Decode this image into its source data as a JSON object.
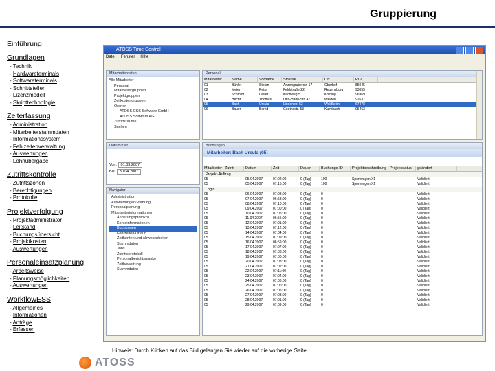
{
  "page": {
    "title": "Gruppierung"
  },
  "nav": {
    "sections": [
      {
        "label": "Einführung",
        "items": []
      },
      {
        "label": "Grundlagen",
        "items": [
          "Technik",
          "Hardwareterminals",
          "Softwareterminals",
          "Schnittstellen",
          "Lizenzmodell",
          "Skripttechnologie"
        ]
      },
      {
        "label": "Zeiterfassung",
        "items": [
          "Administration",
          "Mitarbeiterstammdaten",
          "Informationssystem",
          "Fehlzeitenverwaltung",
          "Auswertungen",
          "Lohnübergabe"
        ]
      },
      {
        "label": "Zutrittskontrolle",
        "items": [
          "Zutrittszonen",
          "Berechtigungen",
          "Protokolle"
        ]
      },
      {
        "label": "Projektverfolgung",
        "items": [
          "Projektadministrator",
          "Leitstand",
          "Buchungsübersicht",
          "Projektkosten",
          "Auswertungen"
        ]
      },
      {
        "label": "Personaleinsatzplanung",
        "items": [
          "Arbeitsweise",
          "Planungsmöglichkeiten",
          "Auswertungen"
        ]
      },
      {
        "label": "WorkflowESS",
        "items": [
          "Allgemeines",
          "Informationen",
          "Anträge",
          "Erfassen"
        ]
      }
    ]
  },
  "screenshot": {
    "window_title": "ATOSS Time Control",
    "menu": [
      "Datei",
      "Fenster",
      "Hilfe"
    ],
    "employees_header": [
      "Mitarbeiter",
      "Name",
      "Vorname",
      "Strasse",
      "Ort",
      "PLZ"
    ],
    "employees": [
      [
        "01",
        "Bühler",
        "Stefan",
        "Anzengruberstr. 17",
        "Oberhof",
        "85045"
      ],
      [
        "02",
        "Meier",
        "Petra",
        "Feldstraße 22",
        "Regensburg",
        "93055"
      ],
      [
        "03",
        "Schmidt",
        "Dieter",
        "Kirchweg 5",
        "Kölbing",
        "96969"
      ],
      [
        "04",
        "Hecht",
        "Thomas",
        "Otto-Hahn-Str. 47",
        "Weiden",
        "92637"
      ],
      [
        "05",
        "Bach",
        "Ursula",
        "Lindenstr. 52",
        "Waldheim",
        "67478"
      ],
      [
        "06",
        "Bauer",
        "Bernd",
        "Goethestr. 53",
        "Kulmbach",
        "95463"
      ]
    ],
    "banner": "Mitarbeiter: Bach Ursula (05)",
    "bookings_header": [
      "Mitarbeiter",
      "Zutritt",
      "Datum",
      "Zeit",
      "Dauer",
      "Buchungs-ID",
      "Projektbeschreibung",
      "Projektstatus",
      "geändert"
    ],
    "group1": "Projekt-Auftrag",
    "group2": "Login",
    "bookings": [
      [
        "05",
        "",
        "05.04.2007",
        "07:02:00",
        "0 (Tag)",
        "100",
        "Sportwagen X1",
        "Validiert"
      ],
      [
        "05",
        "",
        "05.04.2007",
        "07:15:00",
        "0 (Tag)",
        "100",
        "Sportwagen X1",
        "Validiert"
      ],
      [
        "05",
        "",
        "06.04.2007",
        "07:03:00",
        "0 (Tag)",
        "0",
        "",
        "Validiert"
      ],
      [
        "05",
        "",
        "07.04.2007",
        "06:58:00",
        "0 (Tag)",
        "0",
        "",
        "Validiert"
      ],
      [
        "05",
        "",
        "08.04.2007",
        "07:10:00",
        "0 (Tag)",
        "0",
        "",
        "Validiert"
      ],
      [
        "05",
        "",
        "09.04.2007",
        "07:00:00",
        "0 (Tag)",
        "0",
        "",
        "Validiert"
      ],
      [
        "05",
        "",
        "10.04.2007",
        "07:05:00",
        "0 (Tag)",
        "0",
        "",
        "Validiert"
      ],
      [
        "05",
        "",
        "11.04.2007",
        "06:55:00",
        "0 (Tag)",
        "0",
        "",
        "Validiert"
      ],
      [
        "05",
        "",
        "12.04.2007",
        "07:01:00",
        "0 (Tag)",
        "0",
        "",
        "Validiert"
      ],
      [
        "05",
        "",
        "13.04.2007",
        "07:12:00",
        "0 (Tag)",
        "0",
        "",
        "Validiert"
      ],
      [
        "05",
        "",
        "14.04.2007",
        "07:04:00",
        "0 (Tag)",
        "0",
        "",
        "Validiert"
      ],
      [
        "05",
        "",
        "15.04.2007",
        "07:09:00",
        "0 (Tag)",
        "0",
        "",
        "Validiert"
      ],
      [
        "05",
        "",
        "16.04.2007",
        "06:59:00",
        "0 (Tag)",
        "0",
        "",
        "Validiert"
      ],
      [
        "05",
        "",
        "17.04.2007",
        "07:07:00",
        "0 (Tag)",
        "0",
        "",
        "Validiert"
      ],
      [
        "05",
        "",
        "18.04.2007",
        "07:03:00",
        "0 (Tag)",
        "0",
        "",
        "Validiert"
      ],
      [
        "05",
        "",
        "19.04.2007",
        "07:00:00",
        "0 (Tag)",
        "0",
        "",
        "Validiert"
      ],
      [
        "05",
        "",
        "20.04.2007",
        "07:08:00",
        "0 (Tag)",
        "0",
        "",
        "Validiert"
      ],
      [
        "05",
        "",
        "21.04.2007",
        "07:02:00",
        "0 (Tag)",
        "0",
        "",
        "Validiert"
      ],
      [
        "05",
        "",
        "22.04.2007",
        "07:11:00",
        "0 (Tag)",
        "0",
        "",
        "Validiert"
      ],
      [
        "05",
        "",
        "23.04.2007",
        "07:04:00",
        "0 (Tag)",
        "0",
        "",
        "Validiert"
      ],
      [
        "05",
        "",
        "24.04.2007",
        "07:06:00",
        "0 (Tag)",
        "0",
        "",
        "Validiert"
      ],
      [
        "05",
        "",
        "25.04.2007",
        "07:00:00",
        "0 (Tag)",
        "0",
        "",
        "Validiert"
      ],
      [
        "05",
        "",
        "26.04.2007",
        "07:05:00",
        "0 (Tag)",
        "0",
        "",
        "Validiert"
      ],
      [
        "05",
        "",
        "27.04.2007",
        "07:03:00",
        "0 (Tag)",
        "0",
        "",
        "Validiert"
      ],
      [
        "05",
        "",
        "28.04.2007",
        "07:01:00",
        "0 (Tag)",
        "0",
        "",
        "Validiert"
      ],
      [
        "05",
        "",
        "29.04.2007",
        "07:09:00",
        "0 (Tag)",
        "0",
        "",
        "Validiert"
      ]
    ],
    "tree_top": [
      "Alle Mitarbeiter",
      "Personal",
      "Mitarbeitergruppen",
      "Projektgruppen",
      "Zeitkostengruppen",
      "Ordner",
      "ATOSS CSS Software GmbH",
      "ATOSS Software AG",
      "Zutrittsräume",
      "Suchen"
    ],
    "tree_nav": [
      "Administration",
      "Auswertungen/Planung",
      "Personalplanung",
      "Mitarbeiterinformationen",
      "Änderungsprotokoll",
      "Kontoinformationen",
      "Buchungen",
      "Fehlzeiten/Urlaub",
      "Zeitkonten und Abwesenheiten",
      "Stammdaten",
      "Jobs",
      "Zutrittsprotokoll",
      "Personalberichtsmaske",
      "Zeitbewertung",
      "Stammdaten"
    ],
    "filter_from": "01.03.2007",
    "filter_to": "30.04.2007"
  },
  "hint": "Hinweis: Durch Klicken auf das Bild gelangen Sie wieder auf die vorherige Seite",
  "logo": {
    "text": "ATOSS"
  }
}
